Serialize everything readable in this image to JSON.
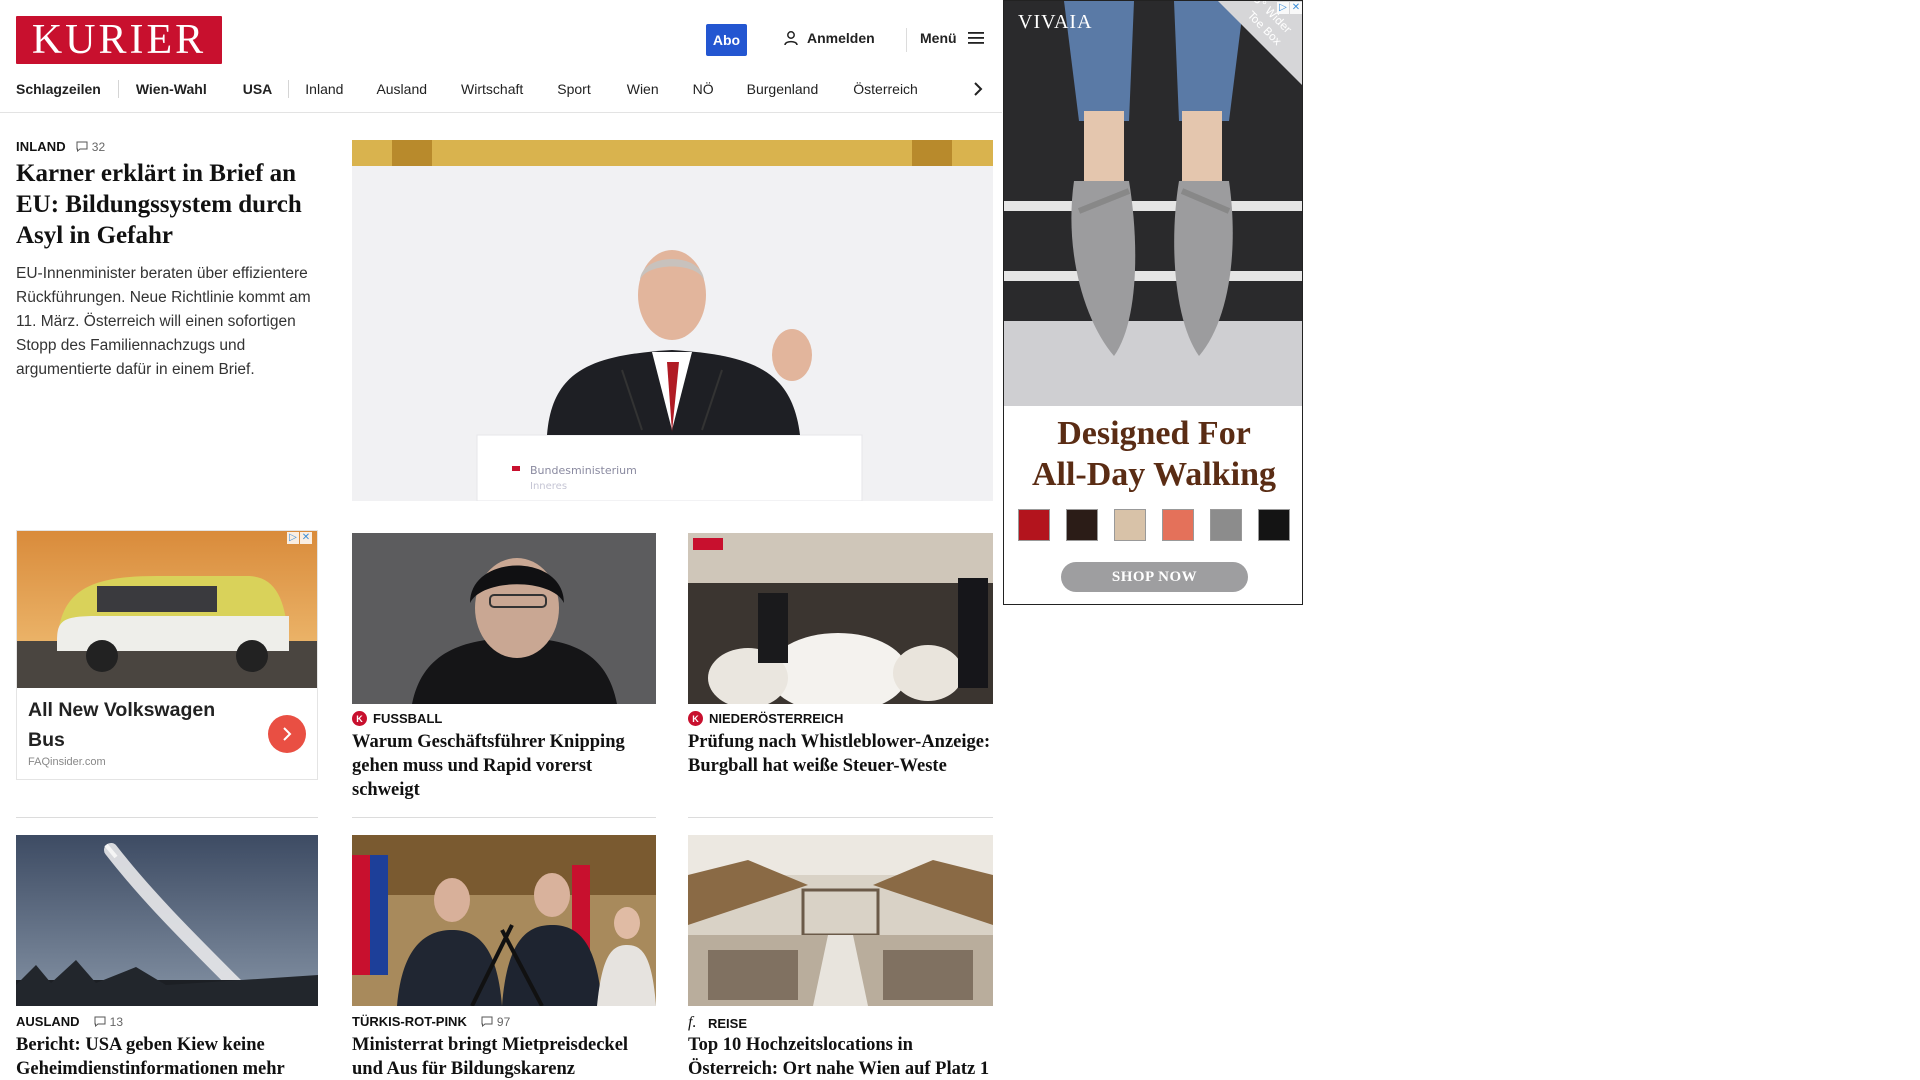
{
  "header": {
    "logo_text": "KURIER",
    "abo_label": "Abo",
    "login_label": "Anmelden",
    "menu_label": "Menü"
  },
  "nav": {
    "items": [
      "Schlagzeilen",
      "Wien-Wahl",
      "USA",
      "Inland",
      "Ausland",
      "Wirtschaft",
      "Sport",
      "Wien",
      "NÖ",
      "Burgenland",
      "Österreich"
    ]
  },
  "lead": {
    "kicker": "INLAND",
    "comments": "32",
    "title": "Karner erklärt in Brief an EU: Bildungssystem durch Asyl in Gefahr",
    "teaser": "EU-Innenminister beraten über effizientere Rückführungen. Neue Richtlinie kommt am 11. März. Österreich will einen sofortigen Stopp des Familiennachzugs und argumentierte dafür in einem Brief.",
    "image_caption_text": "Bundesministerium",
    "image_caption_text2": "Inneres"
  },
  "native_ad": {
    "title": "All New Volkswagen Bus",
    "source": "FAQinsider.com"
  },
  "cards_row1": [
    {
      "kicker": "FUSSBALL",
      "icon": "kurier-k-icon",
      "title": "Warum Geschäftsführer Knipping gehen muss und Rapid vorerst schweigt"
    },
    {
      "kicker": "NIEDERÖSTERREICH",
      "icon": "kurier-k-icon",
      "title": "Prüfung nach Whistleblower-Anzeige: Burgball hat weiße Steuer-Weste"
    }
  ],
  "cards_row2": [
    {
      "kicker": "AUSLAND",
      "comments": "13",
      "title": "Bericht: USA geben Kiew keine Geheimdienstinformationen mehr"
    },
    {
      "kicker": "TÜRKIS-ROT-PINK",
      "comments": "97",
      "title": "Ministerrat bringt Mietpreisdeckel und Aus für Bildungskarenz"
    },
    {
      "kicker": "REISE",
      "icon": "freizeit-f-icon",
      "title": "Top 10 Hochzeitslocations in Österreich: Ort nahe Wien auf Platz 1"
    }
  ],
  "display_ad": {
    "brand": "VIVAIA",
    "ribbon_line1": "5° Wider",
    "ribbon_line2": "Toe Box",
    "headline_line1": "Designed For",
    "headline_line2": "All-Day Walking",
    "cta": "SHOP NOW",
    "swatch_colors": [
      "#b3141d",
      "#2b1c17",
      "#d8c2a8",
      "#e4715a",
      "#8c8c8c",
      "#141414"
    ]
  },
  "colors": {
    "brand_red": "#c8102e",
    "abo_blue": "#2356d1",
    "ad_button": "#e94f43"
  }
}
